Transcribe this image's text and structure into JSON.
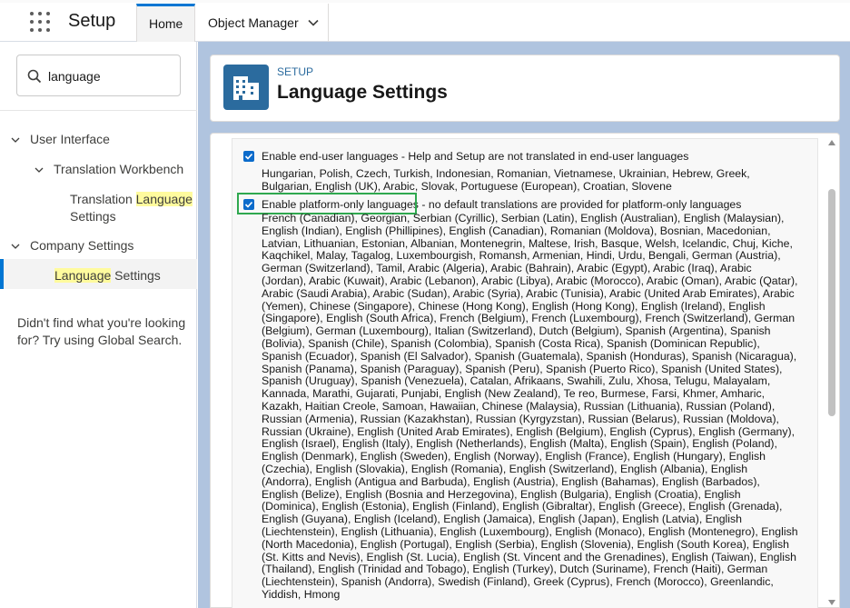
{
  "header": {
    "app_title": "Setup",
    "tabs": [
      {
        "label": "Home"
      },
      {
        "label": "Object Manager"
      }
    ]
  },
  "sidebar": {
    "search_value": "language",
    "items": [
      {
        "label": "User Interface"
      },
      {
        "label": "Translation Workbench"
      },
      {
        "label_before": "Translation ",
        "label_highlight": "Language",
        "label_after": "Settings"
      },
      {
        "label": "Company Settings"
      },
      {
        "label_highlight": "Language",
        "label_after": " Settings"
      }
    ],
    "help_text": "Didn't find what you're looking for? Try using Global Search."
  },
  "page": {
    "eyebrow": "SETUP",
    "title": "Language Settings"
  },
  "settings": {
    "end_user": {
      "label": "Enable end-user languages - Help and Setup are not translated in end-user languages",
      "checked": true,
      "languages": "Hungarian, Polish, Czech, Turkish, Indonesian, Romanian, Vietnamese, Ukrainian, Hebrew, Greek, Bulgarian, English (UK), Arabic, Slovak, Portuguese (European), Croatian, Slovene"
    },
    "platform_only": {
      "label_main": "Enable platform-only languages",
      "label_rest": " - no default translations are provided for platform-only languages",
      "checked": true,
      "languages": "French (Canadian), Georgian, Serbian (Cyrillic), Serbian (Latin), English (Australian), English (Malaysian), English (Indian), English (Phillipines), English (Canadian), Romanian (Moldova), Bosnian, Macedonian, Latvian, Lithuanian, Estonian, Albanian, Montenegrin, Maltese, Irish, Basque, Welsh, Icelandic, Chuj, Kiche, Kaqchikel, Malay, Tagalog, Luxembourgish, Romansh, Armenian, Hindi, Urdu, Bengali, German (Austria), German (Switzerland), Tamil, Arabic (Algeria), Arabic (Bahrain), Arabic (Egypt), Arabic (Iraq), Arabic (Jordan), Arabic (Kuwait), Arabic (Lebanon), Arabic (Libya), Arabic (Morocco), Arabic (Oman), Arabic (Qatar), Arabic (Saudi Arabia), Arabic (Sudan), Arabic (Syria), Arabic (Tunisia), Arabic (United Arab Emirates), Arabic (Yemen), Chinese (Singapore), Chinese (Hong Kong), English (Hong Kong), English (Ireland), English (Singapore), English (South Africa), French (Belgium), French (Luxembourg), French (Switzerland), German (Belgium), German (Luxembourg), Italian (Switzerland), Dutch (Belgium), Spanish (Argentina), Spanish (Bolivia), Spanish (Chile), Spanish (Colombia), Spanish (Costa Rica), Spanish (Dominican Republic), Spanish (Ecuador), Spanish (El Salvador), Spanish (Guatemala), Spanish (Honduras), Spanish (Nicaragua), Spanish (Panama), Spanish (Paraguay), Spanish (Peru), Spanish (Puerto Rico), Spanish (United States), Spanish (Uruguay), Spanish (Venezuela), Catalan, Afrikaans, Swahili, Zulu, Xhosa, Telugu, Malayalam, Kannada, Marathi, Gujarati, Punjabi, English (New Zealand), Te reo, Burmese, Farsi, Khmer, Amharic, Kazakh, Haitian Creole, Samoan, Hawaiian, Chinese (Malaysia), Russian (Lithuania), Russian (Poland), Russian (Armenia), Russian (Kazakhstan), Russian (Kyrgyzstan), Russian (Belarus), Russian (Moldova), Russian (Ukraine), English (United Arab Emirates), English (Belgium), English (Cyprus), English (Germany), English (Israel), English (Italy), English (Netherlands), English (Malta), English (Spain), English (Poland), English (Denmark), English (Sweden), English (Norway), English (France), English (Hungary), English (Czechia), English (Slovakia), English (Romania), English (Switzerland), English (Albania), English (Andorra), English (Antigua and Barbuda), English (Austria), English (Bahamas), English (Barbados), English (Belize), English (Bosnia and Herzegovina), English (Bulgaria), English (Croatia), English (Dominica), English (Estonia), English (Finland), English (Gibraltar), English (Greece), English (Grenada), English (Guyana), English (Iceland), English (Jamaica), English (Japan), English (Latvia), English (Liechtenstein), English (Lithuania), English (Luxembourg), English (Monaco), English (Montenegro), English (North Macedonia), English (Portugal), English (Serbia), English (Slovenia), English (South Korea), English (St. Kitts and Nevis), English (St. Lucia), English (St. Vincent and the Grenadines), English (Taiwan), English (Thailand), English (Trinidad and Tobago), English (Turkey), Dutch (Suriname), French (Haiti), German (Liechtenstein), Spanish (Andorra), Swedish (Finland), Greek (Cyprus), French (Morocco), Greenlandic, Yiddish, Hmong"
    }
  },
  "colors": {
    "brand_blue": "#0176d3",
    "icon_bg": "#2b6b9e",
    "highlight": "#fffb9e",
    "main_bg": "#b0c4df",
    "annotation_green": "#2fa84f"
  },
  "icons": {
    "app_launcher": "waffle-icon",
    "object_manager_menu": "chevron-down-icon",
    "search": "search-icon",
    "setup": "building-icon"
  }
}
